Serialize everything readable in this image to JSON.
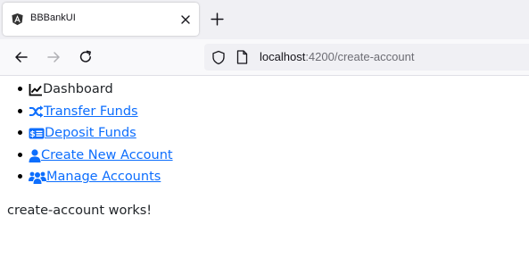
{
  "browser": {
    "tab": {
      "title": "BBBankUI",
      "favicon": "angular-icon"
    },
    "url": {
      "host": "localhost",
      "rest": ":4200/create-account"
    }
  },
  "nav": {
    "items": [
      {
        "label": " Dashboard",
        "icon": "chart-line-icon",
        "is_link": false
      },
      {
        "label": " Transfer Funds",
        "icon": "shuffle-icon",
        "is_link": true
      },
      {
        "label": "Deposit Funds",
        "icon": "money-bill-icon",
        "is_link": true
      },
      {
        "label": " Create New Account",
        "icon": "user-icon",
        "is_link": true
      },
      {
        "label": " Manage Accounts",
        "icon": "users-icon",
        "is_link": true
      }
    ]
  },
  "main": {
    "message": "create-account works!"
  },
  "colors": {
    "link": "#0d6efd",
    "text": "#212529"
  }
}
